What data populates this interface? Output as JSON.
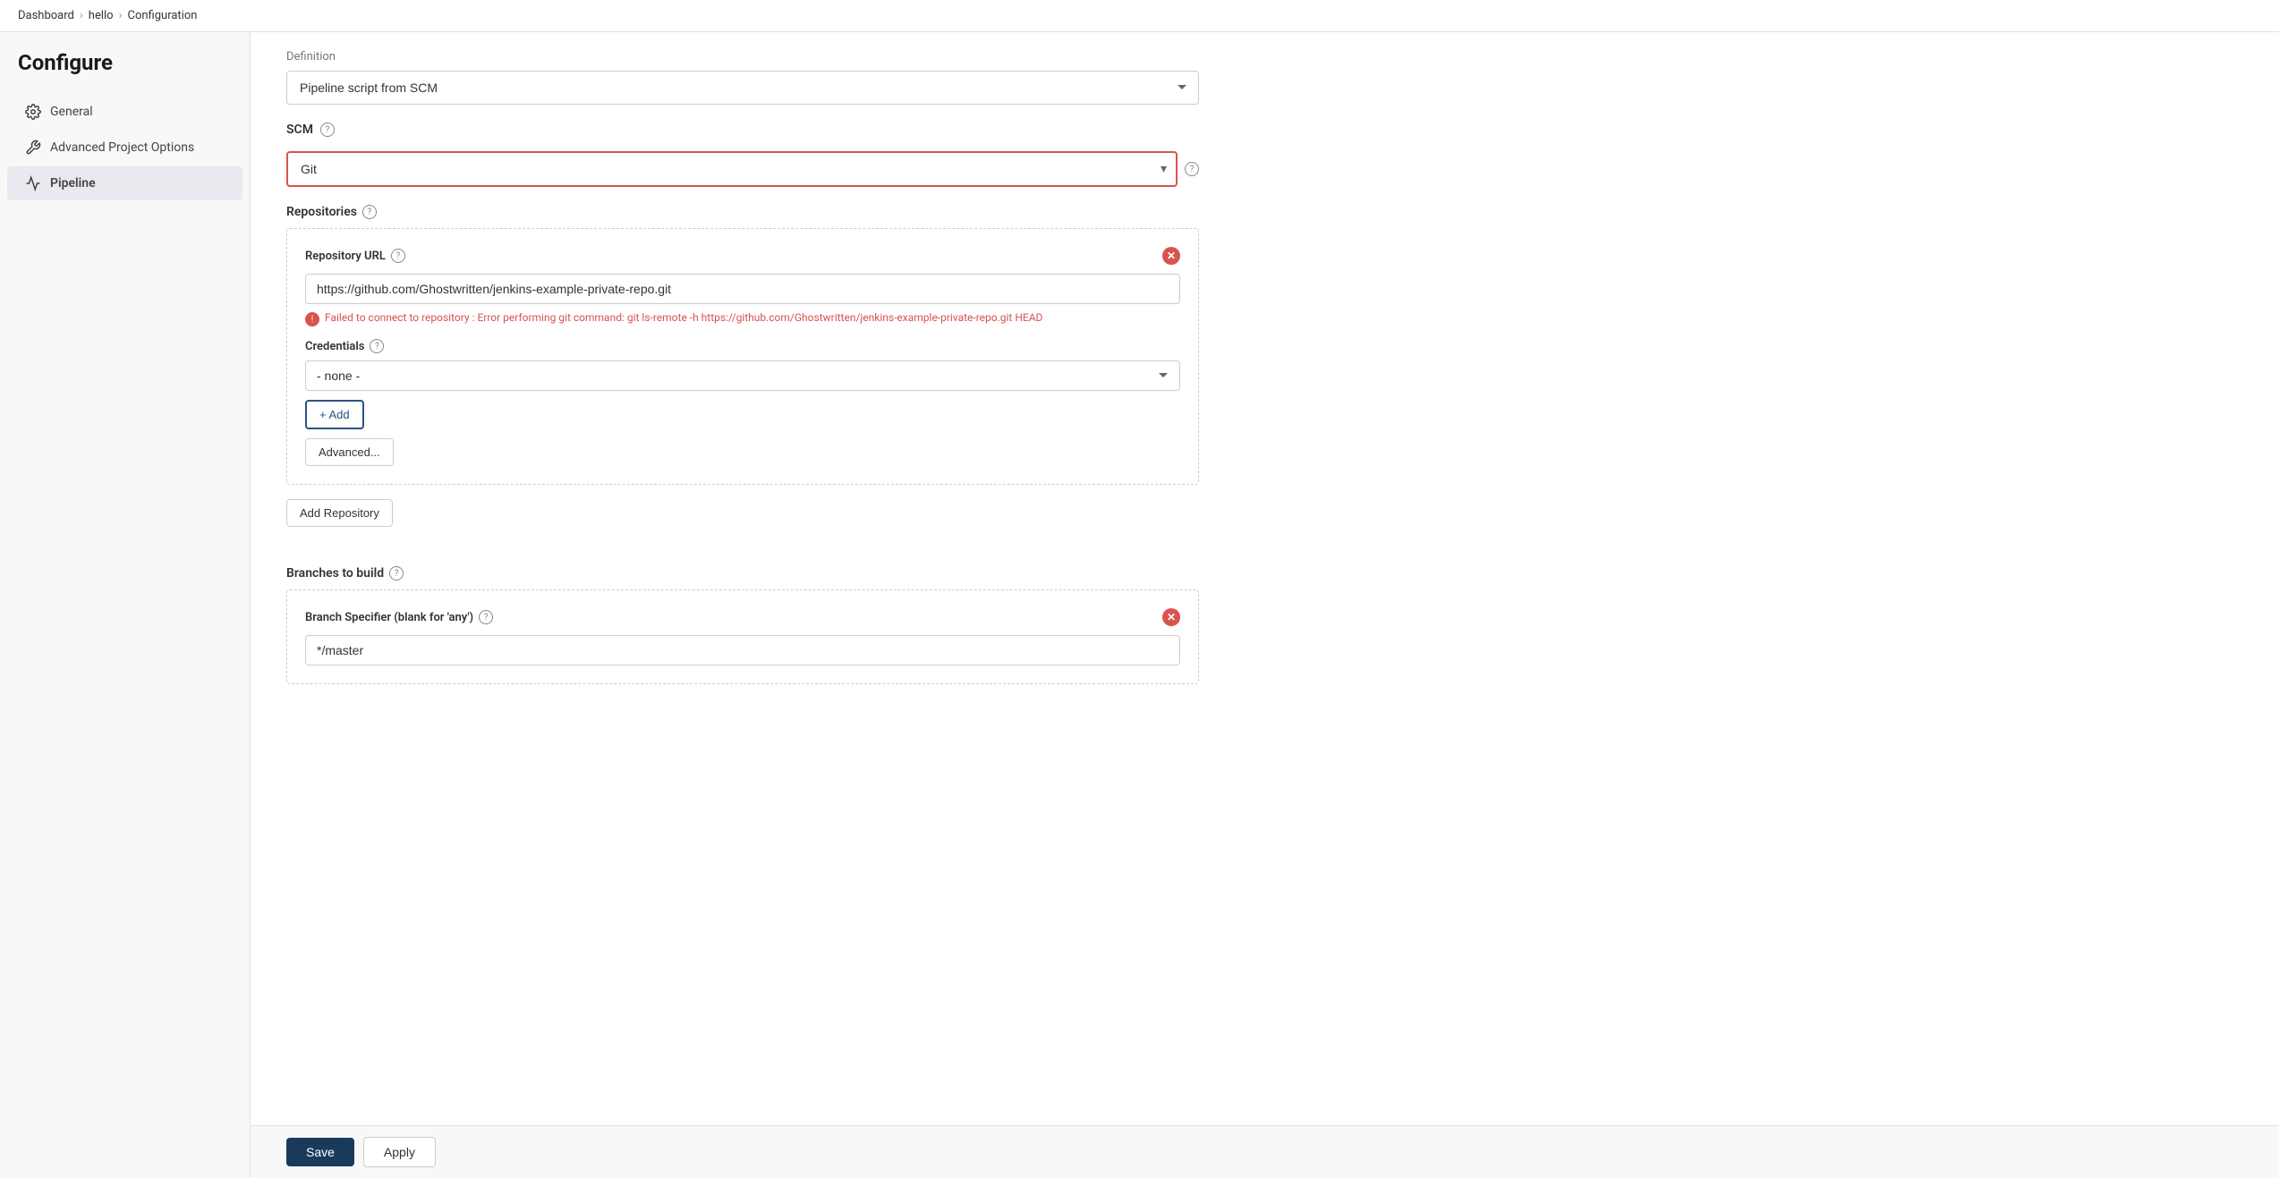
{
  "breadcrumb": {
    "items": [
      "Dashboard",
      "hello",
      "Configuration"
    ]
  },
  "sidebar": {
    "title": "Configure",
    "items": [
      {
        "id": "general",
        "label": "General",
        "icon": "gear"
      },
      {
        "id": "advanced-project-options",
        "label": "Advanced Project Options",
        "icon": "wrench"
      },
      {
        "id": "pipeline",
        "label": "Pipeline",
        "icon": "pipeline",
        "active": true
      }
    ]
  },
  "content": {
    "definition_label": "Definition",
    "pipeline_script_option": "Pipeline script from SCM",
    "scm_label": "SCM",
    "scm_selected": "Git",
    "repositories": {
      "label": "Repositories",
      "repo_url_label": "Repository URL",
      "repo_url_value": "https://github.com/Ghostwritten/jenkins-example-private-repo.git",
      "repo_url_placeholder": "",
      "error_message": "Failed to connect to repository : Error performing git command: git ls-remote -h https://github.com/Ghostwritten/jenkins-example-private-repo.git HEAD",
      "credentials_label": "Credentials",
      "credentials_value": "- none -",
      "add_btn_label": "+ Add",
      "advanced_btn_label": "Advanced..."
    },
    "add_repository_label": "Add Repository",
    "branches": {
      "label": "Branches to build",
      "specifier_label": "Branch Specifier (blank for 'any')",
      "specifier_value": "*/master"
    }
  },
  "footer": {
    "save_label": "Save",
    "apply_label": "Apply"
  }
}
